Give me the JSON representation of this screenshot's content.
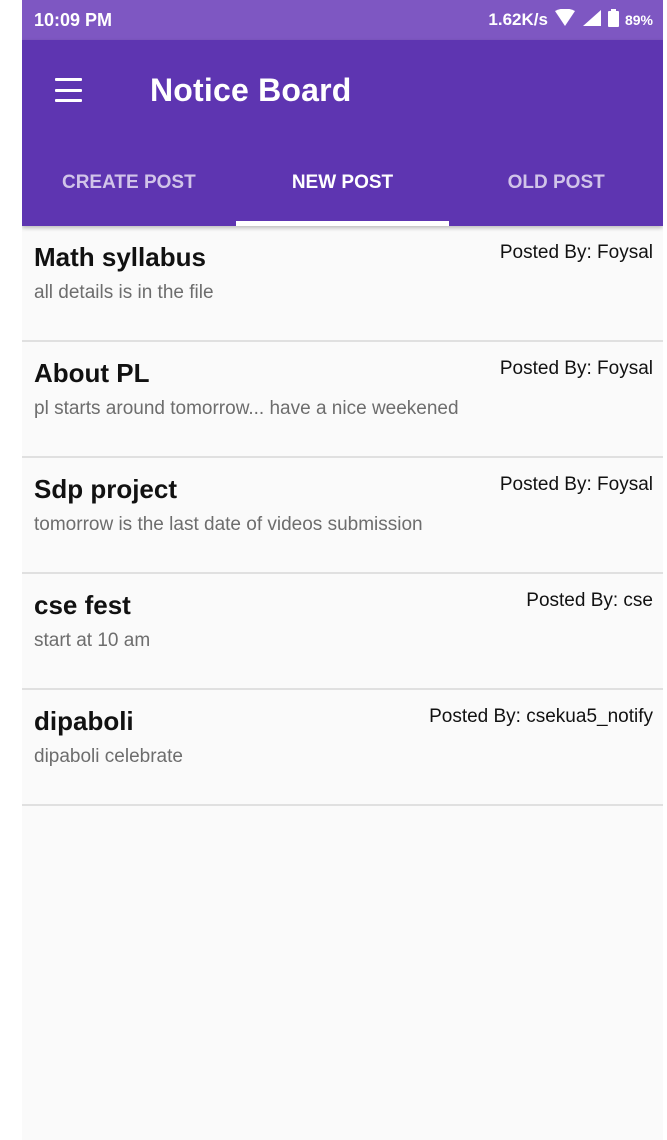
{
  "status_bar": {
    "time": "10:09 PM",
    "network_speed": "1.62K/s",
    "battery": "89%",
    "icons": [
      "wifi-icon",
      "signal-icon",
      "battery-icon"
    ]
  },
  "toolbar": {
    "title": "Notice Board",
    "menu_icon": "hamburger-menu-icon"
  },
  "tabs": [
    {
      "label": "CREATE POST",
      "active": false
    },
    {
      "label": "NEW POST",
      "active": true
    },
    {
      "label": "OLD POST",
      "active": false
    }
  ],
  "posts": [
    {
      "title": "Math syllabus",
      "author": "Posted By: Foysal",
      "body": "all details is in the file"
    },
    {
      "title": "About PL",
      "author": "Posted By: Foysal",
      "body": "pl starts around tomorrow... have a nice weekened"
    },
    {
      "title": "Sdp project",
      "author": "Posted By: Foysal",
      "body": "tomorrow is the last date of videos submission"
    },
    {
      "title": "cse fest",
      "author": "Posted By: cse",
      "body": "start at 10 am"
    },
    {
      "title": "dipaboli",
      "author": "Posted By: csekua5_notify",
      "body": "dipaboli celebrate"
    }
  ],
  "colors": {
    "primary": "#5e35b1",
    "status_bar": "#7e57c2",
    "background": "#fafafa"
  }
}
